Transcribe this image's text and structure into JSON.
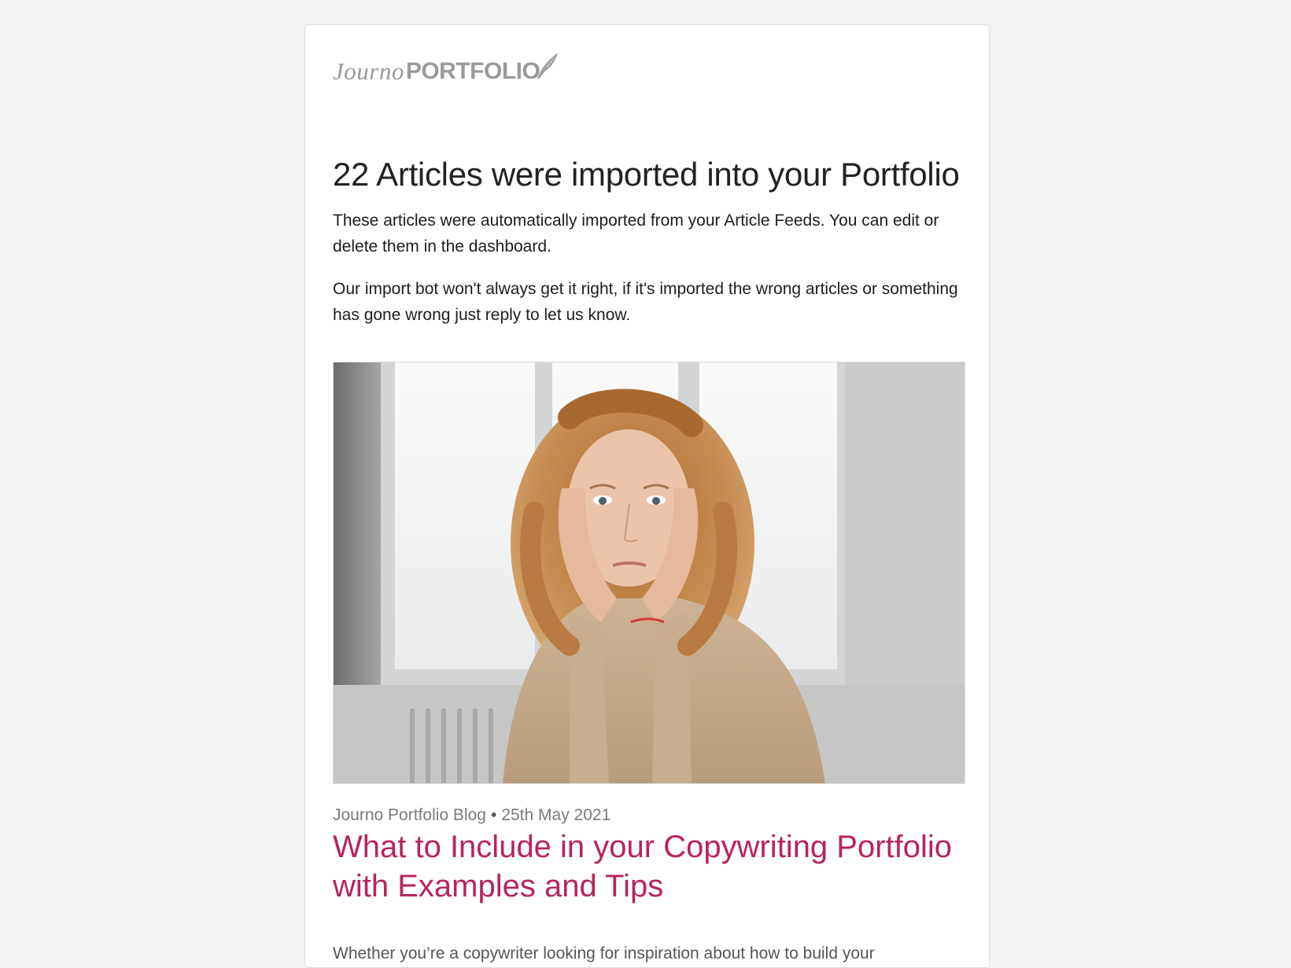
{
  "logo": {
    "script_text": "Journo",
    "bold_text": "PORTFOLIO",
    "icon": "quill-icon",
    "color": "#9a9a9a"
  },
  "email": {
    "heading": "22 Articles were imported into your Portfolio",
    "paragraph_1": "These articles were automatically imported from your Article Feeds. You can edit or delete them in the dashboard.",
    "paragraph_2": "Our import bot won't always get it right, if it's imported the wrong articles or something has gone wrong just reply to let us know."
  },
  "article": {
    "image_alt": "Curly-haired woman resting her face in her hands, looking thoughtfully downward by a bright window",
    "source": "Journo Portfolio Blog",
    "separator": "•",
    "date": "25th May 2021",
    "title": "What to Include in your Copywriting Portfolio with Examples and Tips",
    "excerpt": "Whether you’re a copywriter looking for inspiration about how to build your",
    "title_color": "#b7245f"
  }
}
